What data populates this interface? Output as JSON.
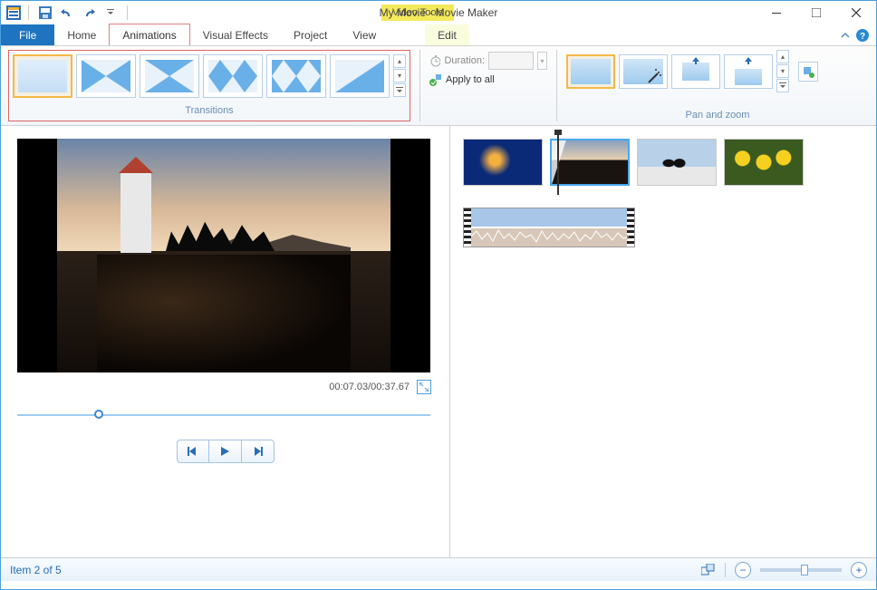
{
  "title": "My Movie - Movie Maker",
  "video_tools_label": "Video Tools",
  "tabs": {
    "file": "File",
    "home": "Home",
    "animations": "Animations",
    "visual_effects": "Visual Effects",
    "project": "Project",
    "view": "View",
    "edit": "Edit"
  },
  "ribbon": {
    "transitions_label": "Transitions",
    "duration_label": "Duration:",
    "apply_all_label": "Apply to all",
    "pan_zoom_label": "Pan and zoom"
  },
  "preview": {
    "timecode": "00:07.03/00:37.67"
  },
  "status": {
    "item_text": "Item 2 of 5"
  },
  "icons": {
    "save": "save-icon",
    "undo": "undo-icon",
    "redo": "redo-icon",
    "minimize": "minimize-icon",
    "maximize": "maximize-icon",
    "close": "close-icon",
    "collapse_ribbon": "chevron-up-icon",
    "help": "help-icon"
  }
}
